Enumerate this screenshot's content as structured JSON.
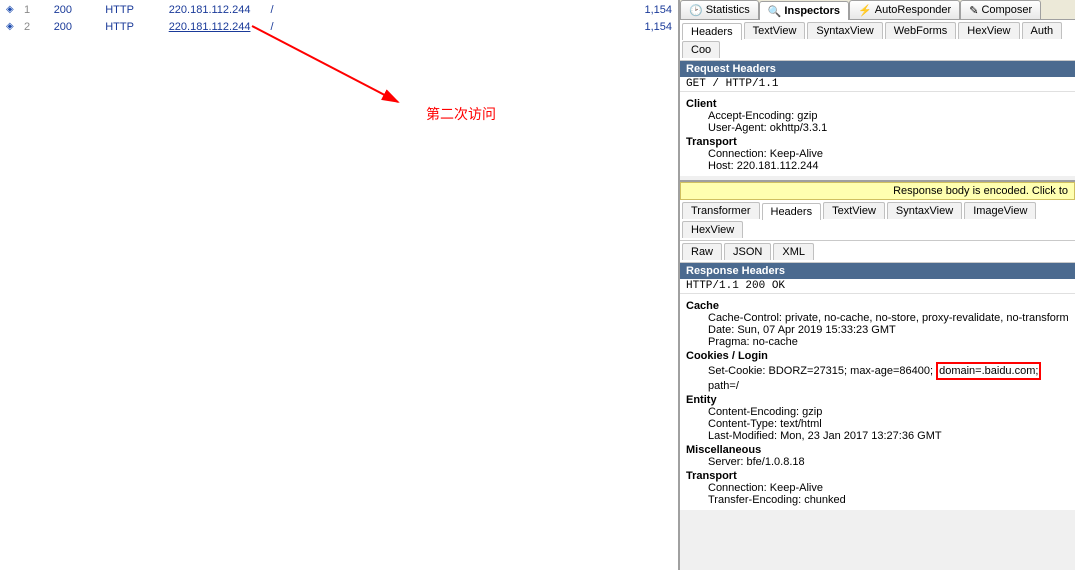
{
  "sessions": [
    {
      "idx": "1",
      "result": "200",
      "protocol": "HTTP",
      "host": "220.181.112.244",
      "url": "/",
      "body": "1,154"
    },
    {
      "idx": "2",
      "result": "200",
      "protocol": "HTTP",
      "host": "220.181.112.244",
      "url": "/",
      "body": "1,154"
    }
  ],
  "annotation": "第二次访问",
  "mainTabs": {
    "statistics": "Statistics",
    "inspectors": "Inspectors",
    "autoresponder": "AutoResponder",
    "composer": "Composer"
  },
  "reqTabs": {
    "headers": "Headers",
    "textview": "TextView",
    "syntaxview": "SyntaxView",
    "webforms": "WebForms",
    "hexview": "HexView",
    "auth": "Auth",
    "cookies": "Coo"
  },
  "reqHeader": {
    "title": "Request Headers",
    "rawLine": "GET / HTTP/1.1",
    "groups": [
      {
        "name": "Client",
        "items": [
          "Accept-Encoding: gzip",
          "User-Agent: okhttp/3.3.1"
        ]
      },
      {
        "name": "Transport",
        "items": [
          "Connection: Keep-Alive",
          "Host: 220.181.112.244"
        ]
      }
    ]
  },
  "respNotice": "Response body is encoded. Click to",
  "respTabs1": {
    "transformer": "Transformer",
    "headers": "Headers",
    "textview": "TextView",
    "syntaxview": "SyntaxView",
    "imageview": "ImageView",
    "hexview": "HexView"
  },
  "respTabs2": {
    "raw": "Raw",
    "json": "JSON",
    "xml": "XML"
  },
  "respHeader": {
    "title": "Response Headers",
    "rawLine": "HTTP/1.1 200 OK",
    "groups": [
      {
        "name": "Cache",
        "items": [
          "Cache-Control: private, no-cache, no-store, proxy-revalidate, no-transform",
          "Date: Sun, 07 Apr 2019 15:33:23 GMT",
          "Pragma: no-cache"
        ]
      },
      {
        "name": "Cookies / Login",
        "items": []
      },
      {
        "name": "Entity",
        "items": [
          "Content-Encoding: gzip",
          "Content-Type: text/html",
          "Last-Modified: Mon, 23 Jan 2017 13:27:36 GMT"
        ]
      },
      {
        "name": "Miscellaneous",
        "items": [
          "Server: bfe/1.0.8.18"
        ]
      },
      {
        "name": "Transport",
        "items": [
          "Connection: Keep-Alive",
          "Transfer-Encoding: chunked"
        ]
      }
    ],
    "cookieLine": {
      "pre": "Set-Cookie: BDORZ=27315; max-age=86400; ",
      "hl": "domain=.baidu.com;",
      "post": " path=/"
    }
  }
}
